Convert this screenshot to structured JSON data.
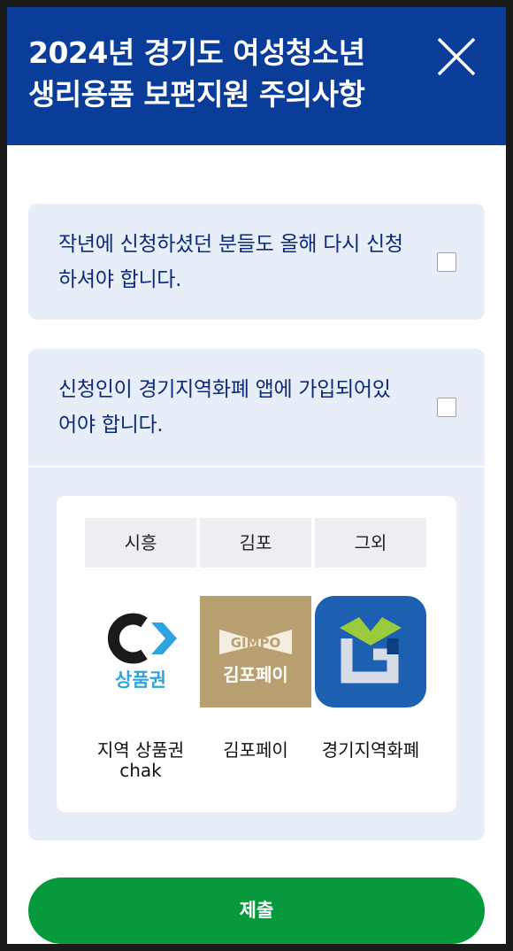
{
  "header": {
    "title": "2024년 경기도 여성청소년\n생리용품 보편지원 주의사항"
  },
  "notices": [
    {
      "text": "작년에 신청하셨던 분들도 올해 다시 신청하셔야 합니다.",
      "checked": false
    },
    {
      "text": "신청인이 경기지역화폐 앱에 가입되어있어야 합니다.",
      "checked": false
    }
  ],
  "apps": {
    "columns": [
      {
        "header": "시흥",
        "name": "지역 상품권 chak",
        "logo_text": "상품권",
        "icon": "chak-logo-icon"
      },
      {
        "header": "김포",
        "name": "김포페이",
        "logo_text": "김포페이",
        "logo_brand": "GIMPO",
        "icon": "gimpo-pay-logo-icon"
      },
      {
        "header": "그외",
        "name": "경기지역화폐",
        "icon": "gyeonggi-currency-app-icon"
      }
    ]
  },
  "submit": {
    "label": "제출"
  },
  "colors": {
    "header_bg": "#0a3d9a",
    "card_bg": "#e8eef8",
    "card_text": "#0d2a78",
    "submit_bg": "#079a3c",
    "gimpo_bg": "#b9a071",
    "gyeonggi_bg": "#1d5fb0"
  }
}
